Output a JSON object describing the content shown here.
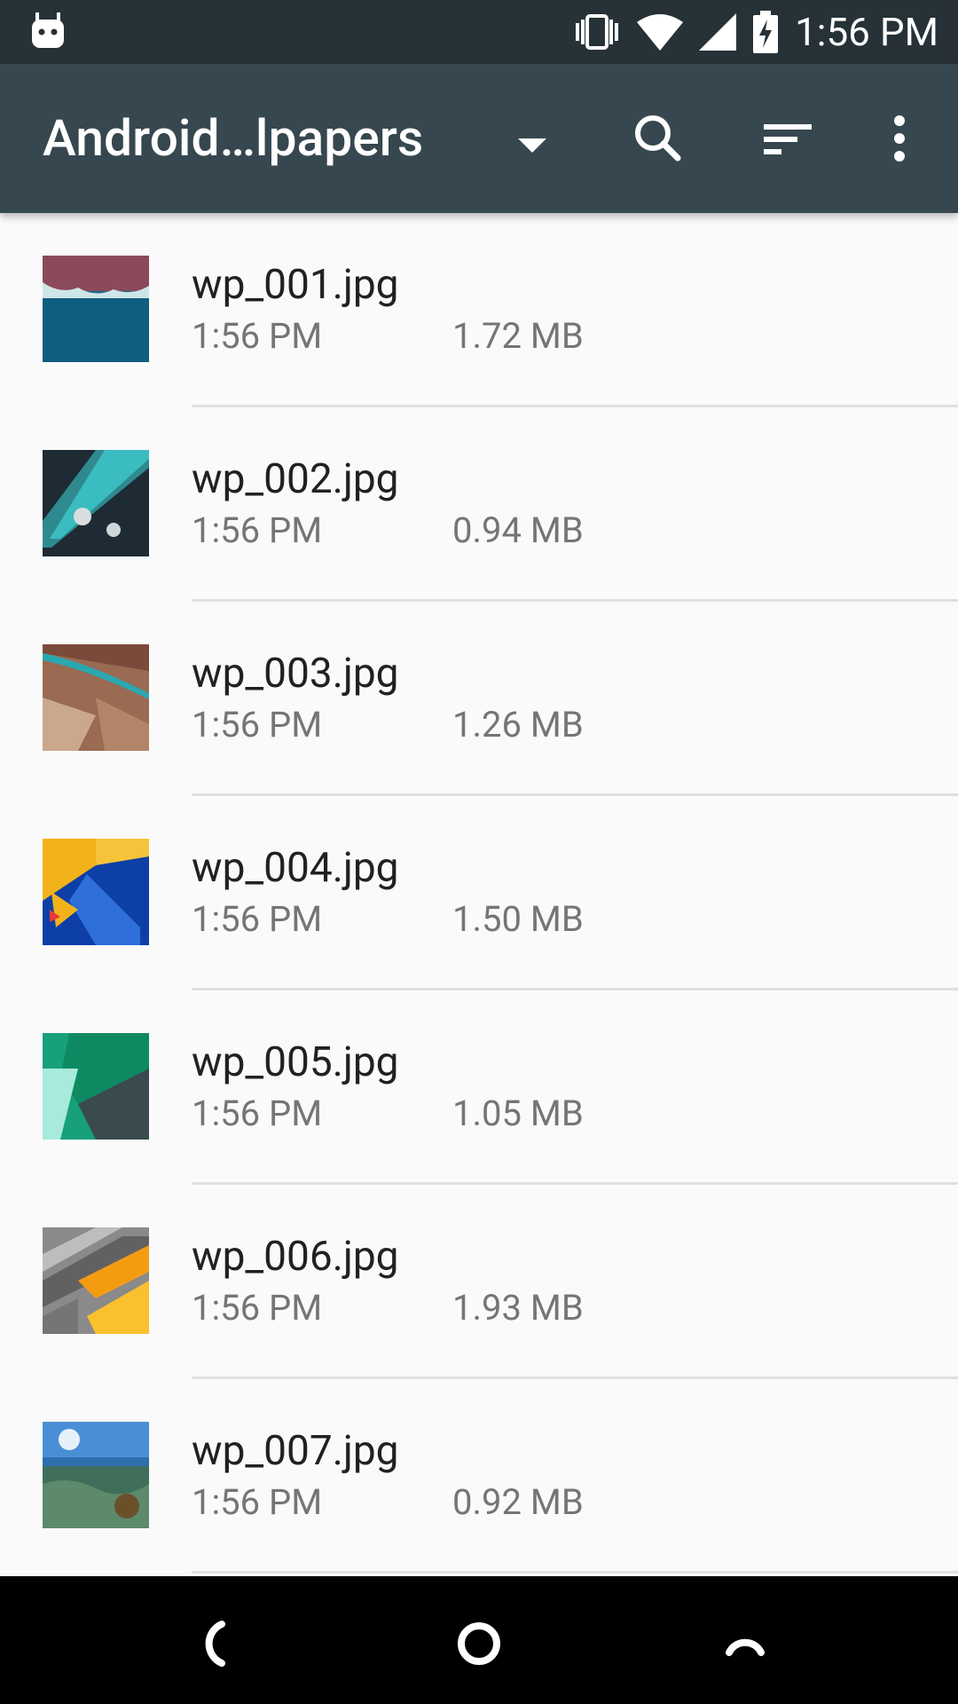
{
  "status": {
    "time": "1:56 PM",
    "icons": [
      "android-debug-icon",
      "vibrate-icon",
      "wifi-icon",
      "signal-icon",
      "battery-charging-icon"
    ]
  },
  "app_bar": {
    "title": "Android…lpapers",
    "icons": [
      "dropdown-arrow-icon",
      "search-icon",
      "sort-icon",
      "more-vert-icon"
    ]
  },
  "files": [
    {
      "name": "wp_001.jpg",
      "time": "1:56 PM",
      "size": "1.72 MB"
    },
    {
      "name": "wp_002.jpg",
      "time": "1:56 PM",
      "size": "0.94 MB"
    },
    {
      "name": "wp_003.jpg",
      "time": "1:56 PM",
      "size": "1.26 MB"
    },
    {
      "name": "wp_004.jpg",
      "time": "1:56 PM",
      "size": "1.50 MB"
    },
    {
      "name": "wp_005.jpg",
      "time": "1:56 PM",
      "size": "1.05 MB"
    },
    {
      "name": "wp_006.jpg",
      "time": "1:56 PM",
      "size": "1.93 MB"
    },
    {
      "name": "wp_007.jpg",
      "time": "1:56 PM",
      "size": "0.92 MB"
    }
  ],
  "nav": {
    "icons": [
      "back-icon",
      "home-icon",
      "recents-icon"
    ]
  },
  "colors": {
    "status_bar": "#263238",
    "app_bar": "#37474f",
    "background": "#fafafa",
    "primary_text": "#212121",
    "secondary_text": "#757575"
  }
}
